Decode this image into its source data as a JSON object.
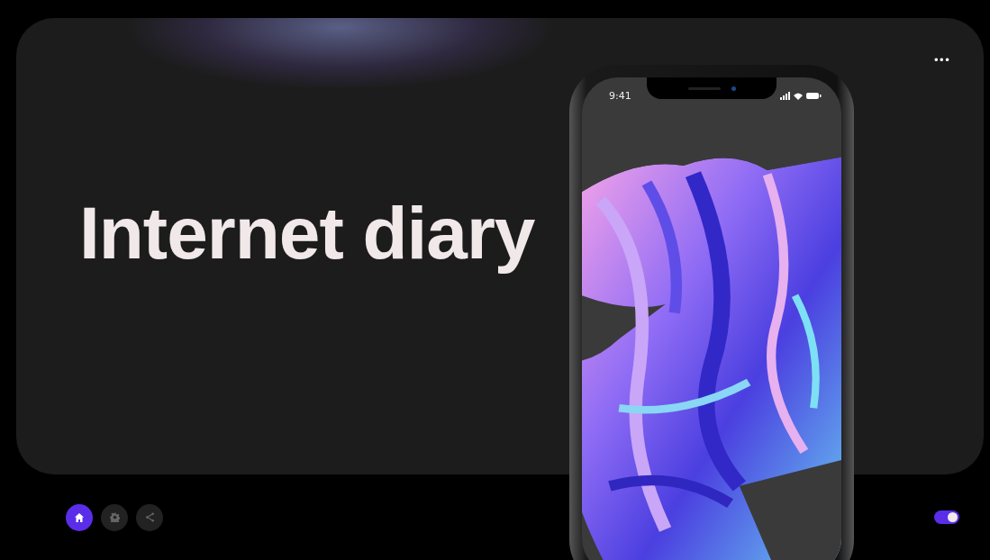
{
  "title": "Internet diary",
  "menu": {
    "label": "•••"
  },
  "phone": {
    "time": "9:41"
  },
  "nav": [
    {
      "kind": "home",
      "selected": true
    },
    {
      "kind": "settings",
      "selected": false
    },
    {
      "kind": "share",
      "selected": false
    }
  ],
  "toggle": {
    "on": true
  }
}
